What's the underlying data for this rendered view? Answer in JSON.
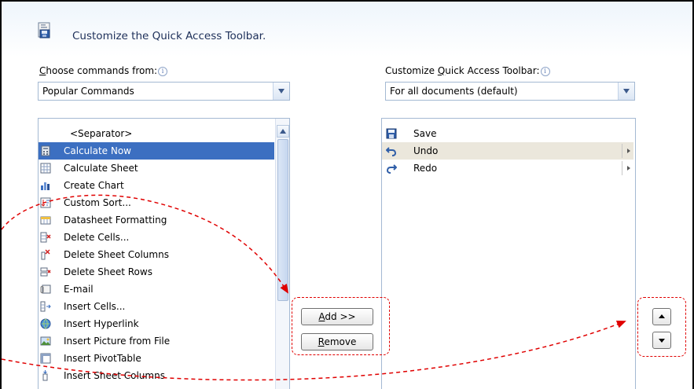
{
  "dialog": {
    "title": "Customize the Quick Access Toolbar."
  },
  "left": {
    "label_prefix": "",
    "label_mnemonic": "C",
    "label_rest": "hoose commands from:",
    "dropdown_value": "Popular Commands",
    "items": [
      {
        "label": "<Separator>",
        "icon": "none"
      },
      {
        "label": "Calculate Now",
        "icon": "calculator-icon"
      },
      {
        "label": "Calculate Sheet",
        "icon": "calculate-sheet-icon"
      },
      {
        "label": "Create Chart",
        "icon": "chart-icon"
      },
      {
        "label": "Custom Sort...",
        "icon": "sort-icon"
      },
      {
        "label": "Datasheet Formatting",
        "icon": "datasheet-icon"
      },
      {
        "label": "Delete Cells...",
        "icon": "delete-cells-icon"
      },
      {
        "label": "Delete Sheet Columns",
        "icon": "delete-columns-icon"
      },
      {
        "label": "Delete Sheet Rows",
        "icon": "delete-rows-icon"
      },
      {
        "label": "E-mail",
        "icon": "email-icon"
      },
      {
        "label": "Insert Cells...",
        "icon": "insert-cells-icon"
      },
      {
        "label": "Insert Hyperlink",
        "icon": "hyperlink-icon"
      },
      {
        "label": "Insert Picture from File",
        "icon": "picture-icon"
      },
      {
        "label": "Insert PivotTable",
        "icon": "pivottable-icon"
      },
      {
        "label": "Insert Sheet Columns",
        "icon": "insert-columns-icon"
      }
    ]
  },
  "right": {
    "label_prefix": "Customize ",
    "label_mnemonic": "Q",
    "label_rest": "uick Access Toolbar:",
    "dropdown_value": "For all documents (default)",
    "items": [
      {
        "label": "Save",
        "icon": "save-icon"
      },
      {
        "label": "Undo",
        "icon": "undo-icon"
      },
      {
        "label": "Redo",
        "icon": "redo-icon"
      }
    ]
  },
  "buttons": {
    "add_mnemonic": "A",
    "add_rest": "dd >>",
    "remove_mnemonic": "R",
    "remove_rest": "emove"
  },
  "info_glyph": "i",
  "colors": {
    "selection": "#3c6fc1",
    "hover_row": "#ebe7dc",
    "annotation": "#e00000",
    "title_text": "#1d2f59"
  }
}
